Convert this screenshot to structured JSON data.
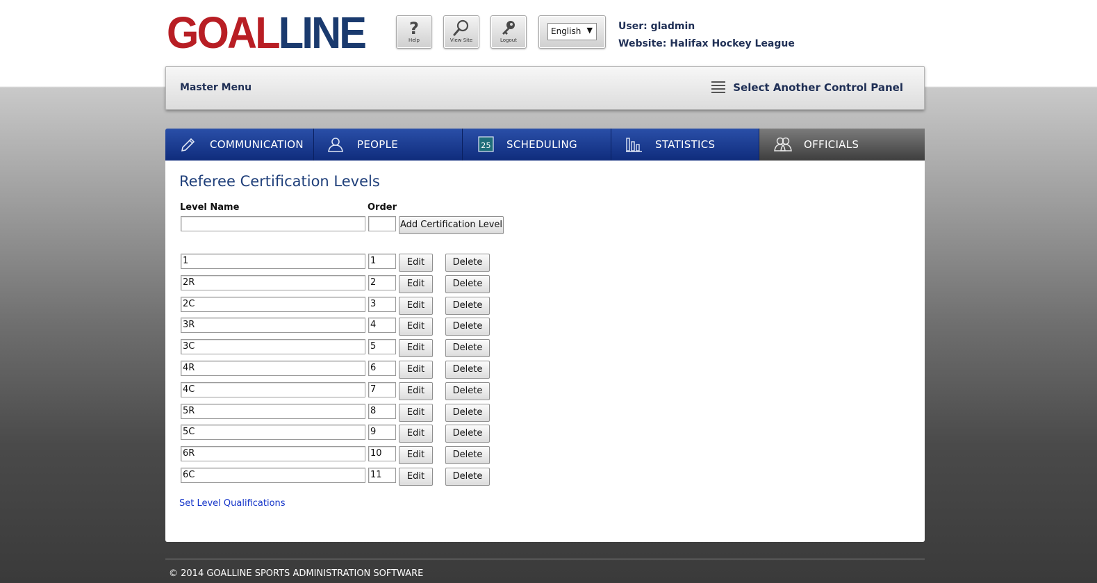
{
  "brand": {
    "logo_part1": "GOAL",
    "logo_part2": "LINE"
  },
  "toolbar": [
    {
      "label": "Help",
      "icon": "question-icon"
    },
    {
      "label": "View Site",
      "icon": "magnifier-icon"
    },
    {
      "label": "Logout",
      "icon": "key-icon"
    }
  ],
  "language": {
    "selected": "English"
  },
  "user": {
    "user_line": "User: gladmin",
    "website_line": "Website: Halifax Hockey League"
  },
  "master_bar": {
    "title": "Master Menu",
    "select_panel": "Select Another Control Panel"
  },
  "nav": {
    "tabs": [
      {
        "label": "COMMUNICATION",
        "icon": "pencil-icon"
      },
      {
        "label": "PEOPLE",
        "icon": "person-icon"
      },
      {
        "label": "SCHEDULING",
        "icon": "calendar-icon",
        "calendar_number": "25"
      },
      {
        "label": "STATISTICS",
        "icon": "bar-chart-icon"
      },
      {
        "label": "OFFICIALS",
        "icon": "officials-icon",
        "active": true
      }
    ]
  },
  "page": {
    "title": "Referee Certification Levels",
    "level_name_header": "Level Name",
    "order_header": "Order",
    "new_level_name": "",
    "new_order": "",
    "add_button": "Add Certification Level",
    "edit_label": "Edit",
    "delete_label": "Delete",
    "levels": [
      {
        "name": "1",
        "order": "1"
      },
      {
        "name": "2R",
        "order": "2"
      },
      {
        "name": "2C",
        "order": "3"
      },
      {
        "name": "3R",
        "order": "4"
      },
      {
        "name": "3C",
        "order": "5"
      },
      {
        "name": "4R",
        "order": "6"
      },
      {
        "name": "4C",
        "order": "7"
      },
      {
        "name": "5R",
        "order": "8"
      },
      {
        "name": "5C",
        "order": "9"
      },
      {
        "name": "6R",
        "order": "10"
      },
      {
        "name": "6C",
        "order": "11"
      }
    ],
    "qualifications_link": "Set Level Qualifications"
  },
  "footer": {
    "copyright": "© 2014 GOALLINE SPORTS ADMINISTRATION SOFTWARE"
  },
  "colors": {
    "nav_blue": "#0f2c7c",
    "brand_red": "#b81e24",
    "brand_navy": "#1a3a6e",
    "link_blue": "#1535c9"
  }
}
